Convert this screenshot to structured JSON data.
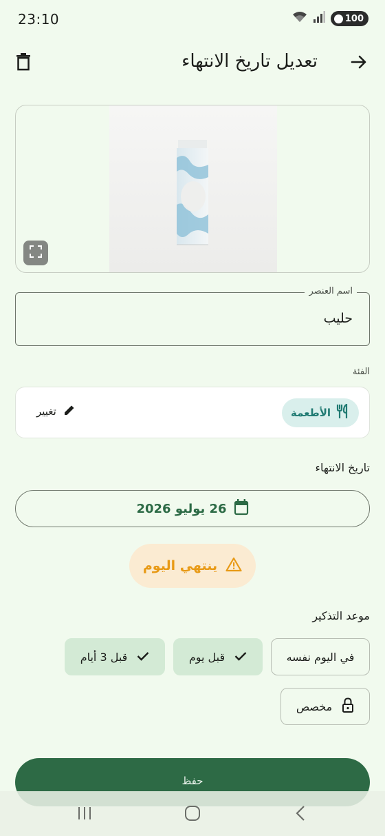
{
  "status_bar": {
    "time": "23:10",
    "battery": "100",
    "icons": [
      "wifi-icon",
      "signal-icon",
      "battery-icon"
    ]
  },
  "app_bar": {
    "title": "تعديل تاريخ الانتهاء",
    "back_icon": "arrow-forward-icon",
    "delete_icon": "trash-icon"
  },
  "image": {
    "expand_icon": "expand-icon"
  },
  "item_name": {
    "label": "اسم العنصر",
    "value": "حليب"
  },
  "category": {
    "label": "الفئة",
    "chip_label": "الأطعمة",
    "chip_icon": "restaurant-icon",
    "change_label": "تغيير",
    "change_icon": "pencil-icon"
  },
  "expiry": {
    "label": "تاريخ الانتهاء",
    "date_label": "26 يوليو 2026",
    "calendar_icon": "calendar-icon"
  },
  "warning": {
    "text": "ينتهي اليوم",
    "icon": "warning-icon"
  },
  "reminder": {
    "label": "موعد التذكير",
    "options": [
      {
        "label": "في اليوم نفسه",
        "selected": false
      },
      {
        "label": "قبل يوم",
        "selected": true
      },
      {
        "label": "قبل 3 أيام",
        "selected": true
      }
    ],
    "custom_label": "مخصص",
    "custom_icon": "lock-icon"
  },
  "save_label": "حفظ",
  "colors": {
    "background": "#f1faee",
    "primary": "#2d6a45",
    "chip_teal_bg": "#d9efec",
    "chip_teal_fg": "#1f7a72",
    "warning_bg": "#fbebd2",
    "warning_fg": "#e89a16",
    "selected_bg": "#d3ead5"
  },
  "nav_bar": {
    "items": [
      "recents-icon",
      "home-icon",
      "back-icon"
    ]
  }
}
